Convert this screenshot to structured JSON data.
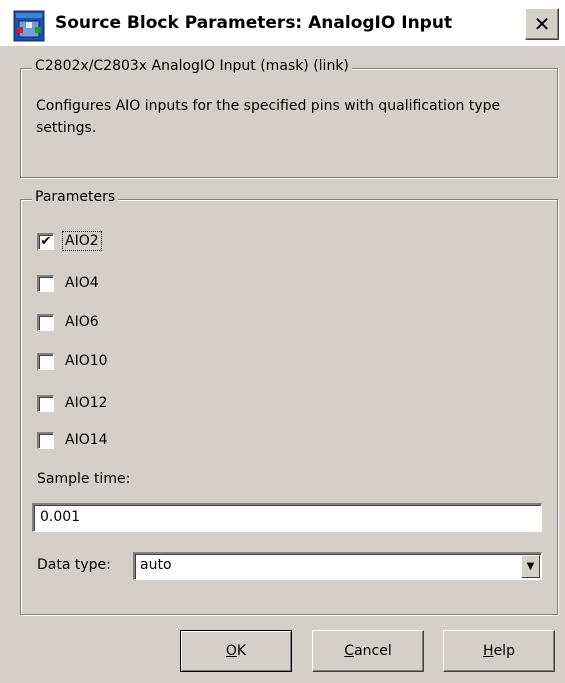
{
  "window": {
    "title": "Source Block Parameters: AnalogIO Input",
    "close_glyph": "✕"
  },
  "mask_group": {
    "legend": "C2802x/C2803x AnalogIO Input (mask) (link)",
    "description": "Configures AIO inputs for the specified pins with qualification type settings."
  },
  "parameters": {
    "legend": "Parameters",
    "checkboxes": [
      {
        "label": "AIO2",
        "checked": true,
        "focused": true
      },
      {
        "label": "AIO4",
        "checked": false,
        "focused": false
      },
      {
        "label": "AIO6",
        "checked": false,
        "focused": false
      },
      {
        "label": "AIO10",
        "checked": false,
        "focused": false
      },
      {
        "label": "AIO12",
        "checked": false,
        "focused": false
      },
      {
        "label": "AIO14",
        "checked": false,
        "focused": false
      }
    ],
    "sample_time_label": "Sample time:",
    "sample_time_value": "0.001",
    "data_type_label": "Data type:",
    "data_type_value": "auto"
  },
  "buttons": {
    "ok": {
      "mnemonic": "O",
      "rest": "K"
    },
    "cancel": {
      "mnemonic": "C",
      "rest": "ancel"
    },
    "help": {
      "mnemonic": "H",
      "rest": "elp"
    }
  },
  "icons": {
    "app": "simulink-block-icon",
    "close": "close-icon",
    "check": "checkmark-icon",
    "dropdown": "chevron-down-icon"
  },
  "colors": {
    "dialog_bg": "#d4d0c8",
    "titlebar_bg": "#ffffff",
    "field_bg": "#ffffff"
  }
}
